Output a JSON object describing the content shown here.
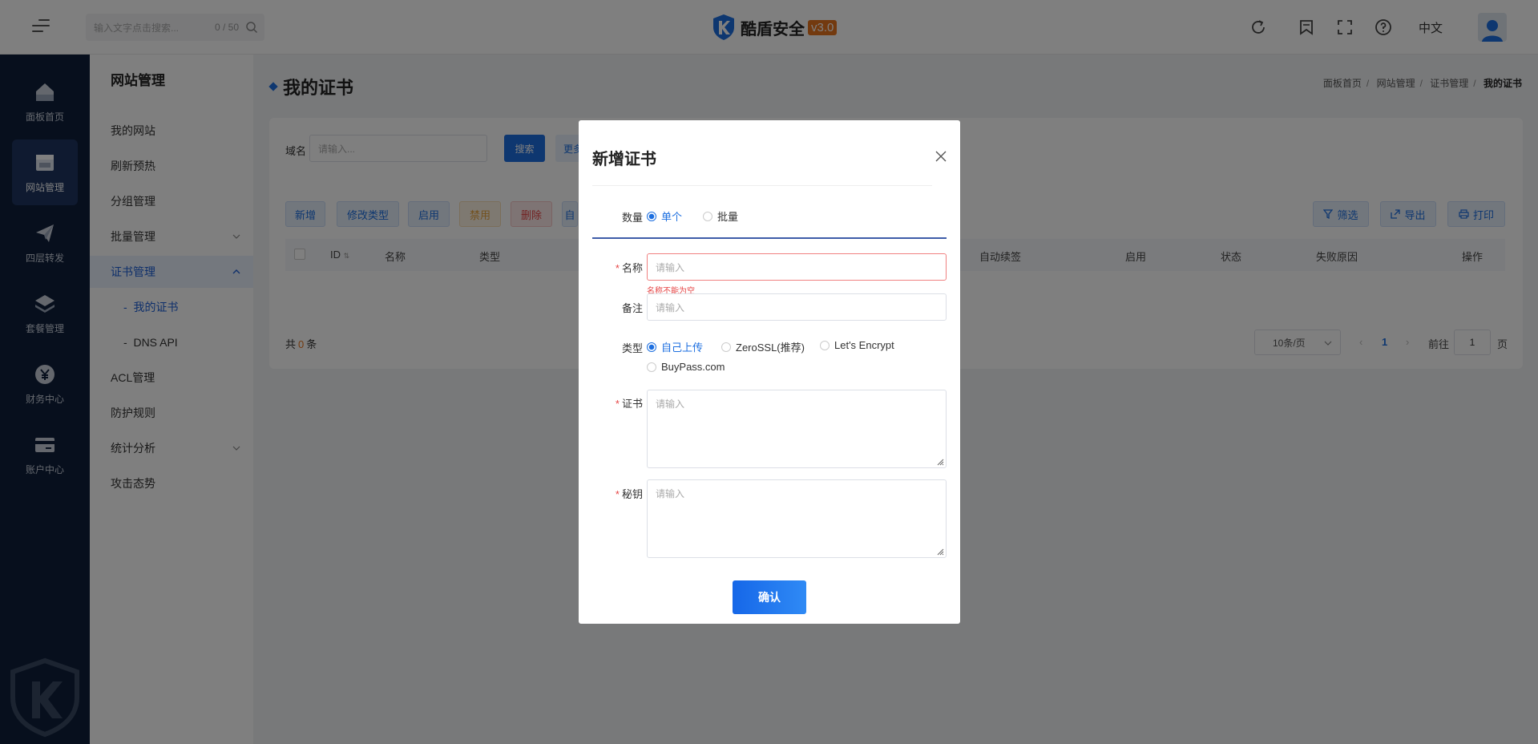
{
  "header": {
    "search_placeholder": "输入文字点击搜索...",
    "search_count": "0 / 50",
    "brand_name": "酷盾安全",
    "version": "v3.0",
    "language": "中文"
  },
  "leftnav": {
    "items": [
      {
        "label": "面板首页",
        "icon": "home-icon"
      },
      {
        "label": "网站管理",
        "icon": "window-icon"
      },
      {
        "label": "四层转发",
        "icon": "paper-plane-icon"
      },
      {
        "label": "套餐管理",
        "icon": "layers-icon"
      },
      {
        "label": "财务中心",
        "icon": "yen-icon"
      },
      {
        "label": "账户中心",
        "icon": "card-icon"
      }
    ]
  },
  "sidebar": {
    "title": "网站管理",
    "items": [
      {
        "label": "我的网站"
      },
      {
        "label": "刷新预热"
      },
      {
        "label": "分组管理"
      },
      {
        "label": "批量管理"
      },
      {
        "label": "证书管理"
      },
      {
        "label": "我的证书"
      },
      {
        "label": "DNS API"
      },
      {
        "label": "ACL管理"
      },
      {
        "label": "防护规则"
      },
      {
        "label": "统计分析"
      },
      {
        "label": "攻击态势"
      }
    ]
  },
  "page": {
    "title": "我的证书",
    "breadcrumb": [
      "面板首页",
      "网站管理",
      "证书管理",
      "我的证书"
    ],
    "breadcrumb_sep": "/"
  },
  "filter": {
    "label": "域名",
    "placeholder": "请输入...",
    "search_label": "搜索",
    "more_label": "更多"
  },
  "toolbar": {
    "add": "新增",
    "modify_type": "修改类型",
    "enable": "启用",
    "disable": "禁用",
    "delete": "删除",
    "extra": "自",
    "filter": "筛选",
    "export": "导出",
    "print": "打印",
    "colors": {
      "add": "#1d6fe0",
      "enable": "#1d6fe0",
      "disable": "#e6a23c",
      "delete": "#e64545"
    }
  },
  "table": {
    "columns": [
      "ID",
      "名称",
      "类型",
      "自动续签",
      "启用",
      "状态",
      "失败原因",
      "操作"
    ]
  },
  "pagination": {
    "total_prefix": "共",
    "total_count": "0",
    "total_suffix": "条",
    "page_size": "10条/页",
    "current_page": "1",
    "goto_label": "前往",
    "goto_value": "1",
    "goto_unit": "页"
  },
  "modal": {
    "title": "新增证书",
    "quantity_label": "数量",
    "quantity_options": [
      "单个",
      "批量"
    ],
    "name_label": "名称",
    "name_placeholder": "请输入",
    "name_error": "名称不能为空",
    "remark_label": "备注",
    "remark_placeholder": "请输入",
    "type_label": "类型",
    "type_options": [
      "自己上传",
      "ZeroSSL(推荐)",
      "Let's Encrypt",
      "BuyPass.com"
    ],
    "cert_label": "证书",
    "cert_placeholder": "请输入",
    "key_label": "秘钥",
    "key_placeholder": "请输入",
    "confirm_label": "确认"
  }
}
